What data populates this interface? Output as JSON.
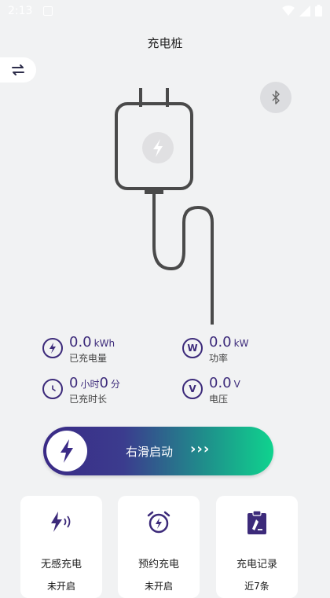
{
  "status_bar": {
    "time": "2:13"
  },
  "page": {
    "title": "充电桩"
  },
  "stats": {
    "energy": {
      "icon": "lightning-icon",
      "value": "0.0",
      "unit": "kWh",
      "label": "已充电量"
    },
    "power": {
      "icon": "w-icon",
      "icon_text": "W",
      "value": "0.0",
      "unit": "kW",
      "label": "功率"
    },
    "duration": {
      "icon": "clock-icon",
      "hours": "0",
      "hours_unit": "小时",
      "minutes": "0",
      "minutes_unit": "分",
      "label": "已充时长"
    },
    "voltage": {
      "icon": "v-icon",
      "icon_text": "V",
      "value": "0.0",
      "unit": "V",
      "label": "电压"
    }
  },
  "slider": {
    "label": "右滑启动",
    "arrows": "›››"
  },
  "cards": [
    {
      "icon": "lightning-wave-icon",
      "title": "无感充电",
      "sub": "未开启"
    },
    {
      "icon": "alarm-clock-icon",
      "title": "预约充电",
      "sub": "未开启"
    },
    {
      "icon": "clipboard-icon",
      "title": "充电记录",
      "sub": "近7条"
    }
  ],
  "colors": {
    "accent": "#3c2a7a",
    "gradient_start": "#3a2a86",
    "gradient_end": "#0fd38e",
    "background": "#f1f2f3"
  }
}
